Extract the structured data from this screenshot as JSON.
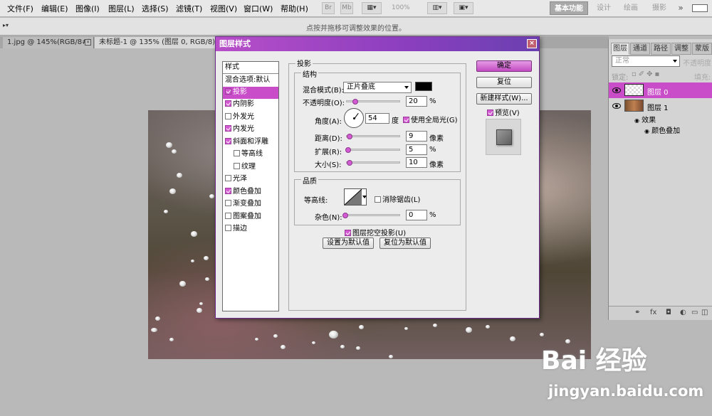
{
  "menubar": {
    "items": [
      "文件(F)",
      "编辑(E)",
      "图像(I)",
      "图层(L)",
      "选择(S)",
      "滤镜(T)",
      "视图(V)",
      "窗口(W)",
      "帮助(H)"
    ],
    "zoom": "100%",
    "workspaces": [
      "基本功能",
      "设计",
      "绘画",
      "摄影"
    ],
    "more": "»"
  },
  "optbar": {
    "hint": "点按并拖移可调整效果的位置。"
  },
  "doc_tabs": [
    {
      "label": "1.jpg @ 145%(RGB/8#)",
      "close": "×"
    },
    {
      "label": "未标题-1 @ 135% (图层 0, RGB/8)",
      "close": "×"
    }
  ],
  "dialog": {
    "title": "图层样式",
    "close": "×",
    "styles_header": "样式",
    "styles": [
      {
        "label": "混合选项:默认",
        "checkbox": false,
        "checked": false,
        "highlight": false,
        "indent": false
      },
      {
        "label": "投影",
        "checkbox": true,
        "checked": true,
        "highlight": true,
        "indent": false
      },
      {
        "label": "内阴影",
        "checkbox": true,
        "checked": true,
        "highlight": false,
        "indent": false
      },
      {
        "label": "外发光",
        "checkbox": true,
        "checked": false,
        "highlight": false,
        "indent": false
      },
      {
        "label": "内发光",
        "checkbox": true,
        "checked": true,
        "highlight": false,
        "indent": false
      },
      {
        "label": "斜面和浮雕",
        "checkbox": true,
        "checked": true,
        "highlight": false,
        "indent": false
      },
      {
        "label": "等高线",
        "checkbox": true,
        "checked": false,
        "highlight": false,
        "indent": true
      },
      {
        "label": "纹理",
        "checkbox": true,
        "checked": false,
        "highlight": false,
        "indent": true
      },
      {
        "label": "光泽",
        "checkbox": true,
        "checked": false,
        "highlight": false,
        "indent": false
      },
      {
        "label": "颜色叠加",
        "checkbox": true,
        "checked": true,
        "highlight": false,
        "indent": false
      },
      {
        "label": "渐变叠加",
        "checkbox": true,
        "checked": false,
        "highlight": false,
        "indent": false
      },
      {
        "label": "图案叠加",
        "checkbox": true,
        "checked": false,
        "highlight": false,
        "indent": false
      },
      {
        "label": "描边",
        "checkbox": true,
        "checked": false,
        "highlight": false,
        "indent": false
      }
    ],
    "section_title": "投影",
    "structure": {
      "title": "结构",
      "blend_mode_label": "混合模式(B):",
      "blend_mode_value": "正片叠底",
      "shadow_color": "#000000",
      "opacity_label": "不透明度(O):",
      "opacity_value": "20",
      "opacity_unit": "%",
      "opacity_fraction": 0.2,
      "angle_label": "角度(A):",
      "angle_value": "54",
      "angle_unit": "度",
      "global_light_label": "使用全局光(G)",
      "global_light_checked": true,
      "distance_label": "距离(D):",
      "distance_value": "9",
      "distance_unit": "像素",
      "distance_fraction": 0.04,
      "spread_label": "扩展(R):",
      "spread_value": "5",
      "spread_unit": "%",
      "spread_fraction": 0.05,
      "size_label": "大小(S):",
      "size_value": "10",
      "size_unit": "像素",
      "size_fraction": 0.04
    },
    "quality": {
      "title": "品质",
      "contour_label": "等高线:",
      "antialias_label": "消除锯齿(L)",
      "antialias_checked": false,
      "noise_label": "杂色(N):",
      "noise_value": "0",
      "noise_unit": "%",
      "noise_fraction": 0.0
    },
    "knockout_label": "图层挖空投影(U)",
    "knockout_checked": true,
    "set_default_label": "设置为默认值",
    "reset_default_label": "复位为默认值",
    "ok_label": "确定",
    "reset_label": "复位",
    "new_style_label": "新建样式(W)...",
    "preview_label": "预览(V)",
    "preview_checked": true
  },
  "layers_panel": {
    "tabs": [
      "图层",
      "通道",
      "路径",
      "调整",
      "蒙版"
    ],
    "blend_mode": "正常",
    "opacity_label": "不透明度:",
    "lock_label": "锁定:",
    "fill_label": "填充:",
    "layers": [
      {
        "name": "图层 0",
        "selected": true
      },
      {
        "name": "图层 1",
        "selected": false
      }
    ],
    "effects_label": "效果",
    "effect_item": "颜色叠加",
    "footer_icons": [
      "link-icon",
      "fx-icon",
      "mask-icon",
      "adjustment-icon",
      "folder-icon",
      "new-layer-icon",
      "trash-icon"
    ]
  },
  "watermark": {
    "logo": "Bai 经验",
    "url": "jingyan.baidu.com"
  },
  "colors": {
    "accent": "#c94cc9",
    "title_bar": "#8a3fbf"
  }
}
